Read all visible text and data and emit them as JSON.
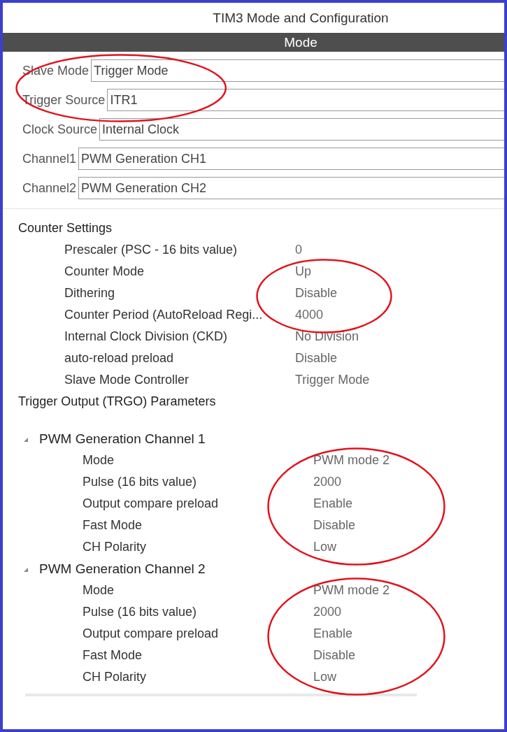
{
  "window": {
    "title": "TIM3 Mode and Configuration"
  },
  "mode": {
    "header": "Mode",
    "fields": [
      {
        "label": "Slave Mode",
        "value": "Trigger Mode",
        "circled": true
      },
      {
        "label": "Trigger Source",
        "value": "ITR1",
        "circled": true
      },
      {
        "label": "Clock Source",
        "value": "Internal Clock",
        "circled": false
      },
      {
        "label": "Channel1",
        "value": "PWM Generation CH1",
        "circled": false
      },
      {
        "label": "Channel2",
        "value": "PWM Generation CH2",
        "circled": false
      }
    ]
  },
  "configuration": {
    "sections": [
      {
        "title": "Counter Settings",
        "rows": [
          {
            "label": "Prescaler (PSC - 16 bits value)",
            "value": "0",
            "circled": false
          },
          {
            "label": "Counter Mode",
            "value": "Up",
            "circled": true
          },
          {
            "label": "Dithering",
            "value": "Disable",
            "circled": true
          },
          {
            "label": "Counter Period (AutoReload Regi...",
            "value": "4000",
            "circled": true
          },
          {
            "label": "Internal Clock Division (CKD)",
            "value": "No Division",
            "circled": false
          },
          {
            "label": "auto-reload preload",
            "value": "Disable",
            "circled": false
          },
          {
            "label": "Slave Mode Controller",
            "value": "Trigger Mode",
            "circled": false
          }
        ]
      },
      {
        "title": "Trigger Output (TRGO) Parameters"
      }
    ],
    "groups": [
      {
        "label": "PWM Generation Channel 1",
        "expanded": true,
        "children": [
          {
            "label": "Mode",
            "value": "PWM mode 2",
            "circled": true
          },
          {
            "label": "Pulse (16 bits value)",
            "value": "2000",
            "circled": true
          },
          {
            "label": "Output compare preload",
            "value": "Enable",
            "circled": true
          },
          {
            "label": "Fast Mode",
            "value": "Disable",
            "circled": true
          },
          {
            "label": "CH Polarity",
            "value": "Low",
            "circled": true
          }
        ]
      },
      {
        "label": "PWM Generation Channel 2",
        "expanded": true,
        "children": [
          {
            "label": "Mode",
            "value": "PWM mode 2",
            "circled": true
          },
          {
            "label": "Pulse (16 bits value)",
            "value": "2000",
            "circled": true
          },
          {
            "label": "Output compare preload",
            "value": "Enable",
            "circled": true
          },
          {
            "label": "Fast Mode",
            "value": "Disable",
            "circled": true
          },
          {
            "label": "CH Polarity",
            "value": "Low",
            "circled": true
          }
        ]
      }
    ]
  }
}
